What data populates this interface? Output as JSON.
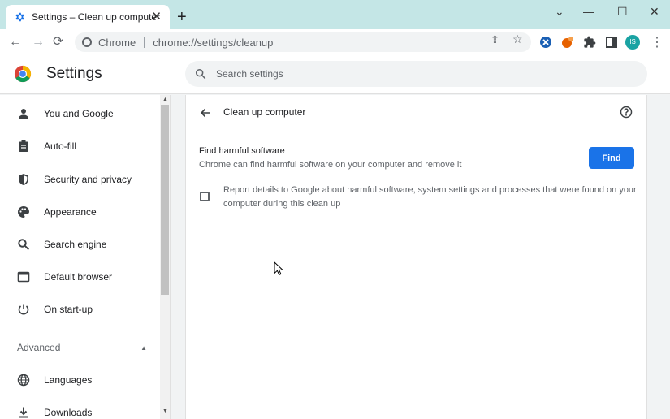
{
  "window": {
    "tab_title": "Settings – Clean up computer",
    "tab_close": "✕",
    "new_tab": "+",
    "minimize": "⌄",
    "maximize": "☐",
    "restore": "—",
    "close": "✕"
  },
  "toolbar": {
    "back": "←",
    "forward": "→",
    "reload": "⟳",
    "omnibox_label": "Chrome",
    "url": "chrome://settings/cleanup",
    "share": "⇪",
    "star": "☆",
    "avatar": "IS",
    "menu": "⋮"
  },
  "header": {
    "title": "Settings",
    "search_placeholder": "Search settings"
  },
  "sidebar": {
    "items": [
      {
        "label": "You and Google",
        "icon": "person-icon"
      },
      {
        "label": "Auto-fill",
        "icon": "clipboard-icon"
      },
      {
        "label": "Security and privacy",
        "icon": "shield-icon"
      },
      {
        "label": "Appearance",
        "icon": "palette-icon"
      },
      {
        "label": "Search engine",
        "icon": "search-icon"
      },
      {
        "label": "Default browser",
        "icon": "browser-icon"
      },
      {
        "label": "On start-up",
        "icon": "power-icon"
      }
    ],
    "advanced_label": "Advanced",
    "advanced_items": [
      {
        "label": "Languages",
        "icon": "globe-icon"
      },
      {
        "label": "Downloads",
        "icon": "download-icon"
      }
    ]
  },
  "main": {
    "page_title": "Clean up computer",
    "find_section": {
      "title": "Find harmful software",
      "description": "Chrome can find harmful software on your computer and remove it",
      "button_label": "Find"
    },
    "report": {
      "checked": false,
      "text": "Report details to Google about harmful software, system settings and processes that were found on your computer during this clean up"
    }
  },
  "colors": {
    "accent": "#1a73e8",
    "titlebar": "#c4e6e6",
    "background": "#f1f3f4"
  }
}
